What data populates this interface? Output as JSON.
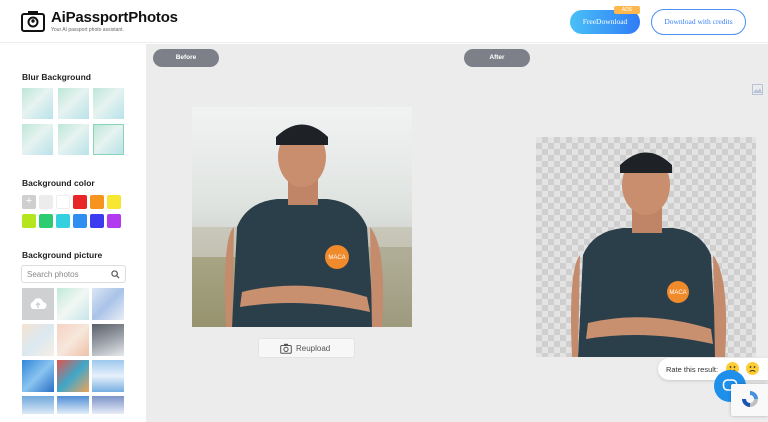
{
  "header": {
    "app_name": "AiPassportPhotos",
    "tagline": "Your AI passport photo assistant.",
    "free_download_label": "FreeDownload",
    "free_badge": "ADS",
    "download_credits_label": "Download with credits",
    "logo_icon": "camera-id-icon"
  },
  "sidebar": {
    "blur_title": "Blur Background",
    "color_title": "Background color",
    "add_color_symbol": "+",
    "colors": [
      "#ececec",
      "#ffffff",
      "#e8262a",
      "#f7941e",
      "#f7e733",
      "#b5e61d",
      "#2ecc71",
      "#33d1e0",
      "#2f8ff0",
      "#3b3bf0",
      "#b23bf0"
    ],
    "picture_title": "Background picture",
    "search_placeholder": "Search photos",
    "search_value": "",
    "upload_icon": "cloud-upload-icon"
  },
  "main": {
    "before_label": "Before",
    "after_label": "After",
    "reupload_label": "Reupload",
    "badge_text": "MACA",
    "rate_label": "Rate this result:",
    "accent_color": "#2f7cf6"
  }
}
